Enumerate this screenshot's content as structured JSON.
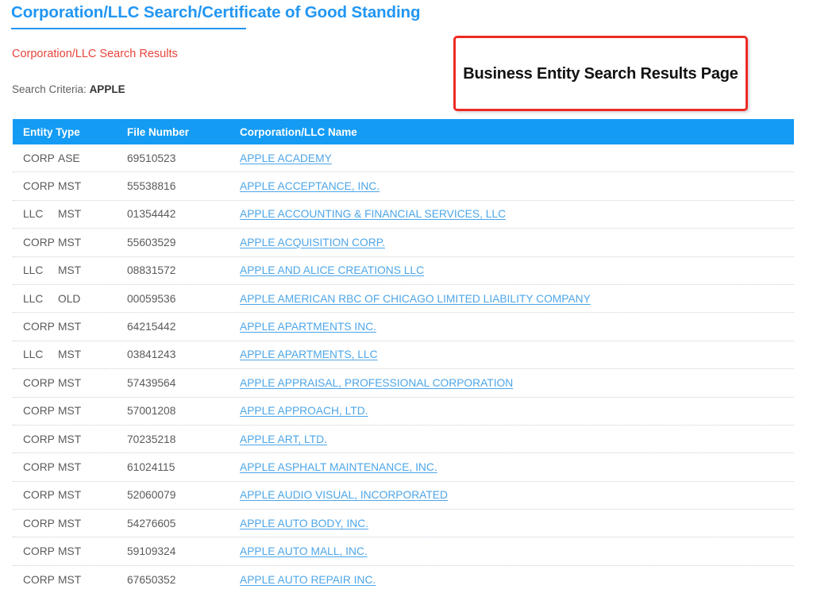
{
  "page": {
    "title": "Corporation/LLC Search/Certificate of Good Standing",
    "results_label": "Corporation/LLC Search Results",
    "search_criteria_label": "Search Criteria:",
    "search_criteria_value": "APPLE",
    "title_color": "#2196f3",
    "results_label_color": "#e8453c"
  },
  "callout": {
    "text": "Business Entity Search Results Page",
    "border_color": "#ee2a23"
  },
  "table": {
    "header_bg": "#149bf3",
    "link_color": "#4da6e8",
    "columns": [
      {
        "key": "entity_type",
        "label": "Entity Type"
      },
      {
        "key": "file_number",
        "label": "File Number"
      },
      {
        "key": "name",
        "label": "Corporation/LLC Name"
      }
    ],
    "rows": [
      {
        "entity_kind": "CORP",
        "entity_status": "ASE",
        "file_number": "69510523",
        "name": "APPLE ACADEMY"
      },
      {
        "entity_kind": "CORP",
        "entity_status": "MST",
        "file_number": "55538816",
        "name": "APPLE ACCEPTANCE, INC."
      },
      {
        "entity_kind": "LLC",
        "entity_status": "MST",
        "file_number": "01354442",
        "name": "APPLE ACCOUNTING & FINANCIAL SERVICES, LLC"
      },
      {
        "entity_kind": "CORP",
        "entity_status": "MST",
        "file_number": "55603529",
        "name": "APPLE ACQUISITION CORP."
      },
      {
        "entity_kind": "LLC",
        "entity_status": "MST",
        "file_number": "08831572",
        "name": "APPLE AND ALICE CREATIONS LLC"
      },
      {
        "entity_kind": "LLC",
        "entity_status": "OLD",
        "file_number": "00059536",
        "name": "APPLE AMERICAN RBC OF CHICAGO LIMITED LIABILITY COMPANY"
      },
      {
        "entity_kind": "CORP",
        "entity_status": "MST",
        "file_number": "64215442",
        "name": "APPLE APARTMENTS INC."
      },
      {
        "entity_kind": "LLC",
        "entity_status": "MST",
        "file_number": "03841243",
        "name": "APPLE APARTMENTS, LLC"
      },
      {
        "entity_kind": "CORP",
        "entity_status": "MST",
        "file_number": "57439564",
        "name": "APPLE APPRAISAL, PROFESSIONAL CORPORATION"
      },
      {
        "entity_kind": "CORP",
        "entity_status": "MST",
        "file_number": "57001208",
        "name": "APPLE APPROACH, LTD."
      },
      {
        "entity_kind": "CORP",
        "entity_status": "MST",
        "file_number": "70235218",
        "name": "APPLE ART, LTD."
      },
      {
        "entity_kind": "CORP",
        "entity_status": "MST",
        "file_number": "61024115",
        "name": "APPLE ASPHALT MAINTENANCE, INC."
      },
      {
        "entity_kind": "CORP",
        "entity_status": "MST",
        "file_number": "52060079",
        "name": "APPLE AUDIO VISUAL, INCORPORATED"
      },
      {
        "entity_kind": "CORP",
        "entity_status": "MST",
        "file_number": "54276605",
        "name": "APPLE AUTO BODY, INC."
      },
      {
        "entity_kind": "CORP",
        "entity_status": "MST",
        "file_number": "59109324",
        "name": "APPLE AUTO MALL, INC."
      },
      {
        "entity_kind": "CORP",
        "entity_status": "MST",
        "file_number": "67650352",
        "name": "APPLE AUTO REPAIR INC."
      }
    ]
  }
}
